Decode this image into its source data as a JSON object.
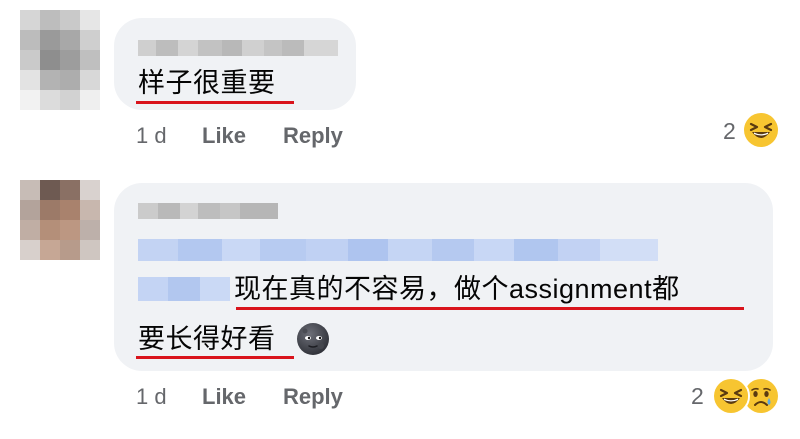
{
  "comments": [
    {
      "text_lines": [
        "样子很重要"
      ],
      "time": "1 d",
      "like_label": "Like",
      "reply_label": "Reply",
      "reaction_count": "2",
      "reactions": [
        "laughing-face"
      ]
    },
    {
      "text_lines": [
        "现在真的不容易，做个assignment都",
        "要长得好看"
      ],
      "time": "1 d",
      "like_label": "Like",
      "reply_label": "Reply",
      "reaction_count": "2",
      "reactions": [
        "laughing-face",
        "sad-face"
      ],
      "inline_emoji": "new-moon-face"
    }
  ],
  "colors": {
    "bubble": "#f0f2f5",
    "meta_text": "#65676b",
    "underline": "#d9141c",
    "blur_gray": "#c8c8c8",
    "blur_blue": "#b9cdf3"
  }
}
